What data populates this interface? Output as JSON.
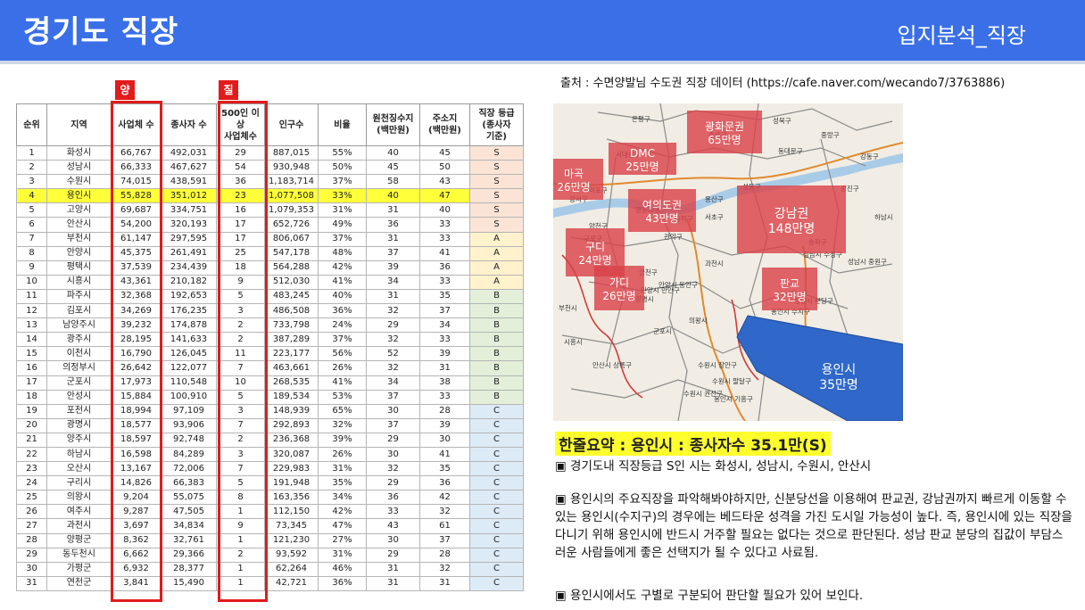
{
  "header": {
    "title": "경기도 직장",
    "subtitle": "입지분석_직장"
  },
  "tags": {
    "quantity": "양",
    "quality": "질"
  },
  "table": {
    "headers": [
      "순위",
      "지역",
      "사업체 수",
      "종사자 수",
      "500인 이상\n사업체수",
      "인구수",
      "비율",
      "원천징수지\n(백만원)",
      "주소지\n(백만원)",
      "직장 등급\n(종사자\n기준)"
    ],
    "rows": [
      [
        "1",
        "화성시",
        "66,767",
        "492,031",
        "29",
        "887,015",
        "55%",
        "40",
        "45",
        "S"
      ],
      [
        "2",
        "성남시",
        "66,333",
        "467,627",
        "54",
        "930,948",
        "50%",
        "45",
        "50",
        "S"
      ],
      [
        "3",
        "수원시",
        "74,015",
        "438,591",
        "36",
        "1,183,714",
        "37%",
        "58",
        "43",
        "S"
      ],
      [
        "4",
        "용인시",
        "55,828",
        "351,012",
        "23",
        "1,077,508",
        "33%",
        "40",
        "47",
        "S"
      ],
      [
        "5",
        "고양시",
        "69,687",
        "334,751",
        "16",
        "1,079,353",
        "31%",
        "31",
        "40",
        "S"
      ],
      [
        "6",
        "안산시",
        "54,200",
        "320,193",
        "17",
        "652,726",
        "49%",
        "36",
        "33",
        "S"
      ],
      [
        "7",
        "부천시",
        "61,147",
        "297,595",
        "17",
        "806,067",
        "37%",
        "31",
        "33",
        "A"
      ],
      [
        "8",
        "안양시",
        "45,375",
        "261,491",
        "25",
        "547,178",
        "48%",
        "37",
        "41",
        "A"
      ],
      [
        "9",
        "평택시",
        "37,539",
        "234,439",
        "18",
        "564,288",
        "42%",
        "39",
        "36",
        "A"
      ],
      [
        "10",
        "시흥시",
        "43,361",
        "210,182",
        "9",
        "512,030",
        "41%",
        "34",
        "33",
        "A"
      ],
      [
        "11",
        "파주시",
        "32,368",
        "192,653",
        "5",
        "483,245",
        "40%",
        "31",
        "35",
        "B"
      ],
      [
        "12",
        "김포시",
        "34,269",
        "176,235",
        "3",
        "486,508",
        "36%",
        "32",
        "37",
        "B"
      ],
      [
        "13",
        "남양주시",
        "39,232",
        "174,878",
        "2",
        "733,798",
        "24%",
        "29",
        "34",
        "B"
      ],
      [
        "14",
        "광주시",
        "28,195",
        "141,633",
        "2",
        "387,289",
        "37%",
        "32",
        "33",
        "B"
      ],
      [
        "15",
        "이천시",
        "16,790",
        "126,045",
        "11",
        "223,177",
        "56%",
        "52",
        "39",
        "B"
      ],
      [
        "16",
        "의정부시",
        "26,642",
        "122,077",
        "7",
        "463,661",
        "26%",
        "32",
        "31",
        "B"
      ],
      [
        "17",
        "군포시",
        "17,973",
        "110,548",
        "10",
        "268,535",
        "41%",
        "34",
        "38",
        "B"
      ],
      [
        "18",
        "안성시",
        "15,884",
        "100,910",
        "5",
        "189,534",
        "53%",
        "37",
        "33",
        "B"
      ],
      [
        "19",
        "포천시",
        "18,994",
        "97,109",
        "3",
        "148,939",
        "65%",
        "30",
        "28",
        "C"
      ],
      [
        "20",
        "광명시",
        "18,577",
        "93,906",
        "7",
        "292,893",
        "32%",
        "37",
        "39",
        "C"
      ],
      [
        "21",
        "양주시",
        "18,597",
        "92,748",
        "2",
        "236,368",
        "39%",
        "29",
        "30",
        "C"
      ],
      [
        "22",
        "하남시",
        "16,598",
        "84,289",
        "3",
        "320,087",
        "26%",
        "30",
        "41",
        "C"
      ],
      [
        "23",
        "오산시",
        "13,167",
        "72,006",
        "7",
        "229,983",
        "31%",
        "32",
        "35",
        "C"
      ],
      [
        "24",
        "구리시",
        "14,826",
        "66,383",
        "5",
        "191,948",
        "35%",
        "29",
        "36",
        "C"
      ],
      [
        "25",
        "의왕시",
        "9,204",
        "55,075",
        "8",
        "163,356",
        "34%",
        "36",
        "42",
        "C"
      ],
      [
        "26",
        "여주시",
        "9,287",
        "47,505",
        "1",
        "112,150",
        "42%",
        "33",
        "32",
        "C"
      ],
      [
        "27",
        "과천시",
        "3,697",
        "34,834",
        "9",
        "73,345",
        "47%",
        "43",
        "61",
        "C"
      ],
      [
        "28",
        "양평군",
        "8,362",
        "32,761",
        "1",
        "121,230",
        "27%",
        "30",
        "37",
        "C"
      ],
      [
        "29",
        "동두천시",
        "6,662",
        "29,366",
        "2",
        "93,592",
        "31%",
        "29",
        "28",
        "C"
      ],
      [
        "30",
        "가평군",
        "6,932",
        "28,377",
        "1",
        "62,264",
        "46%",
        "31",
        "32",
        "C"
      ],
      [
        "31",
        "연천군",
        "3,841",
        "15,490",
        "1",
        "42,721",
        "36%",
        "31",
        "31",
        "C"
      ]
    ]
  },
  "source": "출처 : 수면양발님 수도권 직장 데이터 (https://cafe.naver.com/wecando7/3763886)",
  "map": {
    "labels": [
      {
        "id": "gwanghwamun",
        "name": "광화문권",
        "value": "65만명"
      },
      {
        "id": "dmc",
        "name": "DMC",
        "value": "25만명"
      },
      {
        "id": "mapo",
        "name": "마곡",
        "value": "26만명"
      },
      {
        "id": "yeouido",
        "name": "여의도권",
        "value": "43만명"
      },
      {
        "id": "gangnam",
        "name": "강남권",
        "value": "148만명"
      },
      {
        "id": "guro",
        "name": "구디",
        "value": "24만명"
      },
      {
        "id": "gasan",
        "name": "가디",
        "value": "26만명"
      },
      {
        "id": "pangyo",
        "name": "판교",
        "value": "32만명"
      },
      {
        "id": "yongin",
        "name": "용인시",
        "value": "35만명"
      }
    ],
    "place_names": [
      "은평구",
      "종로구",
      "성북구",
      "중랑구",
      "동대문구",
      "광진구",
      "강동구",
      "서대문구",
      "마포구",
      "용산구",
      "성동구",
      "서초구",
      "송파구",
      "관악구",
      "금천구",
      "강서구",
      "양천구",
      "영등포구",
      "동작구",
      "구로구",
      "과천시",
      "광명시",
      "안양시 만안구",
      "안양시 동안구",
      "의왕시",
      "군포시",
      "안산시 상록구",
      "수원시 장안구",
      "수원시 권선구",
      "수원시 팔달구",
      "성남시 수정구",
      "성남시 중원구",
      "성남시 분당구",
      "하남시",
      "용인시 수지구",
      "용인시 기흥구",
      "부천시",
      "시흥시"
    ]
  },
  "summary": "한줄요약 : 용인시 : 종사자수 35.1만(S)",
  "notes": [
    "▣ 경기도내 직장등급 S인 시는 화성시, 성남시, 수원시, 안산시",
    "▣ 용인시의 주요직장을 파악해봐야하지만, 신분당선을 이용해여 판교권, 강남권까지 빠르게 이동할 수 있는 용인시(수지구)의 경우에는 베드타운 성격을 가진 도시일 가능성이 높다. 즉, 용인시에 있는 직장을 다니기 위해 용인시에 반드시 거주할 필요는 없다는 것으로 판단된다. 성남 판교 분당의 집값이 부담스러운 사람들에게 좋은 선택지가 될 수 있다고 사료됨.",
    "▣ 용인시에서도 구별로 구분되어 판단할 필요가 있어 보인다."
  ],
  "colors": {
    "header_bg": "#3a6fe8",
    "highlight": "#ffff3a",
    "frame_red": "#e21b1b",
    "grade_S": "#fbe4d6",
    "grade_A": "#fff2cc",
    "grade_B": "#e3efd9",
    "grade_C": "#ddebf7",
    "map_box": "#d9434b",
    "yongin_fill": "#2f68c8"
  }
}
